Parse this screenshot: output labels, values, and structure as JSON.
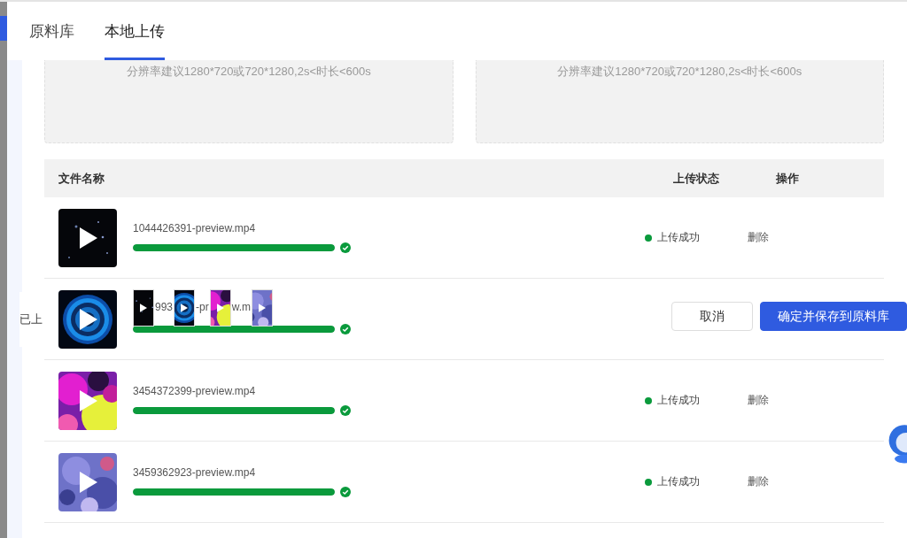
{
  "tabs": [
    {
      "label": "原料库",
      "selected": false
    },
    {
      "label": "本地上传",
      "selected": true
    }
  ],
  "upload_boxes": [
    {
      "hint": "分辨率建议1280*720或720*1280,2s<时长<600s"
    },
    {
      "hint": "分辨率建议1280*720或720*1280,2s<时长<600s"
    }
  ],
  "table": {
    "columns": [
      "文件名称",
      "上传状态",
      "操作"
    ],
    "rows": [
      {
        "thumb": {
          "kind": "picture"
        },
        "name": "1044426391-preview.mp4",
        "level": 1,
        "done": true,
        "status": "上传成功",
        "action": "删除"
      },
      {
        "thumb": {
          "kind": "picture"
        },
        "name_parts": [
          {
            "kind": "picture"
          },
          {
            "kind": "text",
            "text": "993"
          },
          {
            "kind": "picture"
          },
          {
            "kind": "text",
            "text": "-pr"
          },
          {
            "kind": "picture"
          },
          {
            "kind": "text",
            "text": "w.m"
          },
          {
            "kind": "picture"
          }
        ],
        "level": 1,
        "done": true
      },
      {
        "thumb": {
          "kind": "picture"
        },
        "name": "3454372399-preview.mp4",
        "level": 1,
        "done": true,
        "status": "上传成功",
        "action": "删除"
      },
      {
        "thumb": {
          "kind": "picture"
        },
        "name": "3459362923-preview.mp4",
        "level": 1,
        "done": true,
        "status": "上传成功",
        "action": "删除"
      }
    ]
  },
  "side_tab": "已上",
  "popup_buttons": [
    {
      "label": "取消",
      "kind": "secondary"
    },
    {
      "label": "确定并保存到原料库",
      "kind": "primary"
    }
  ]
}
